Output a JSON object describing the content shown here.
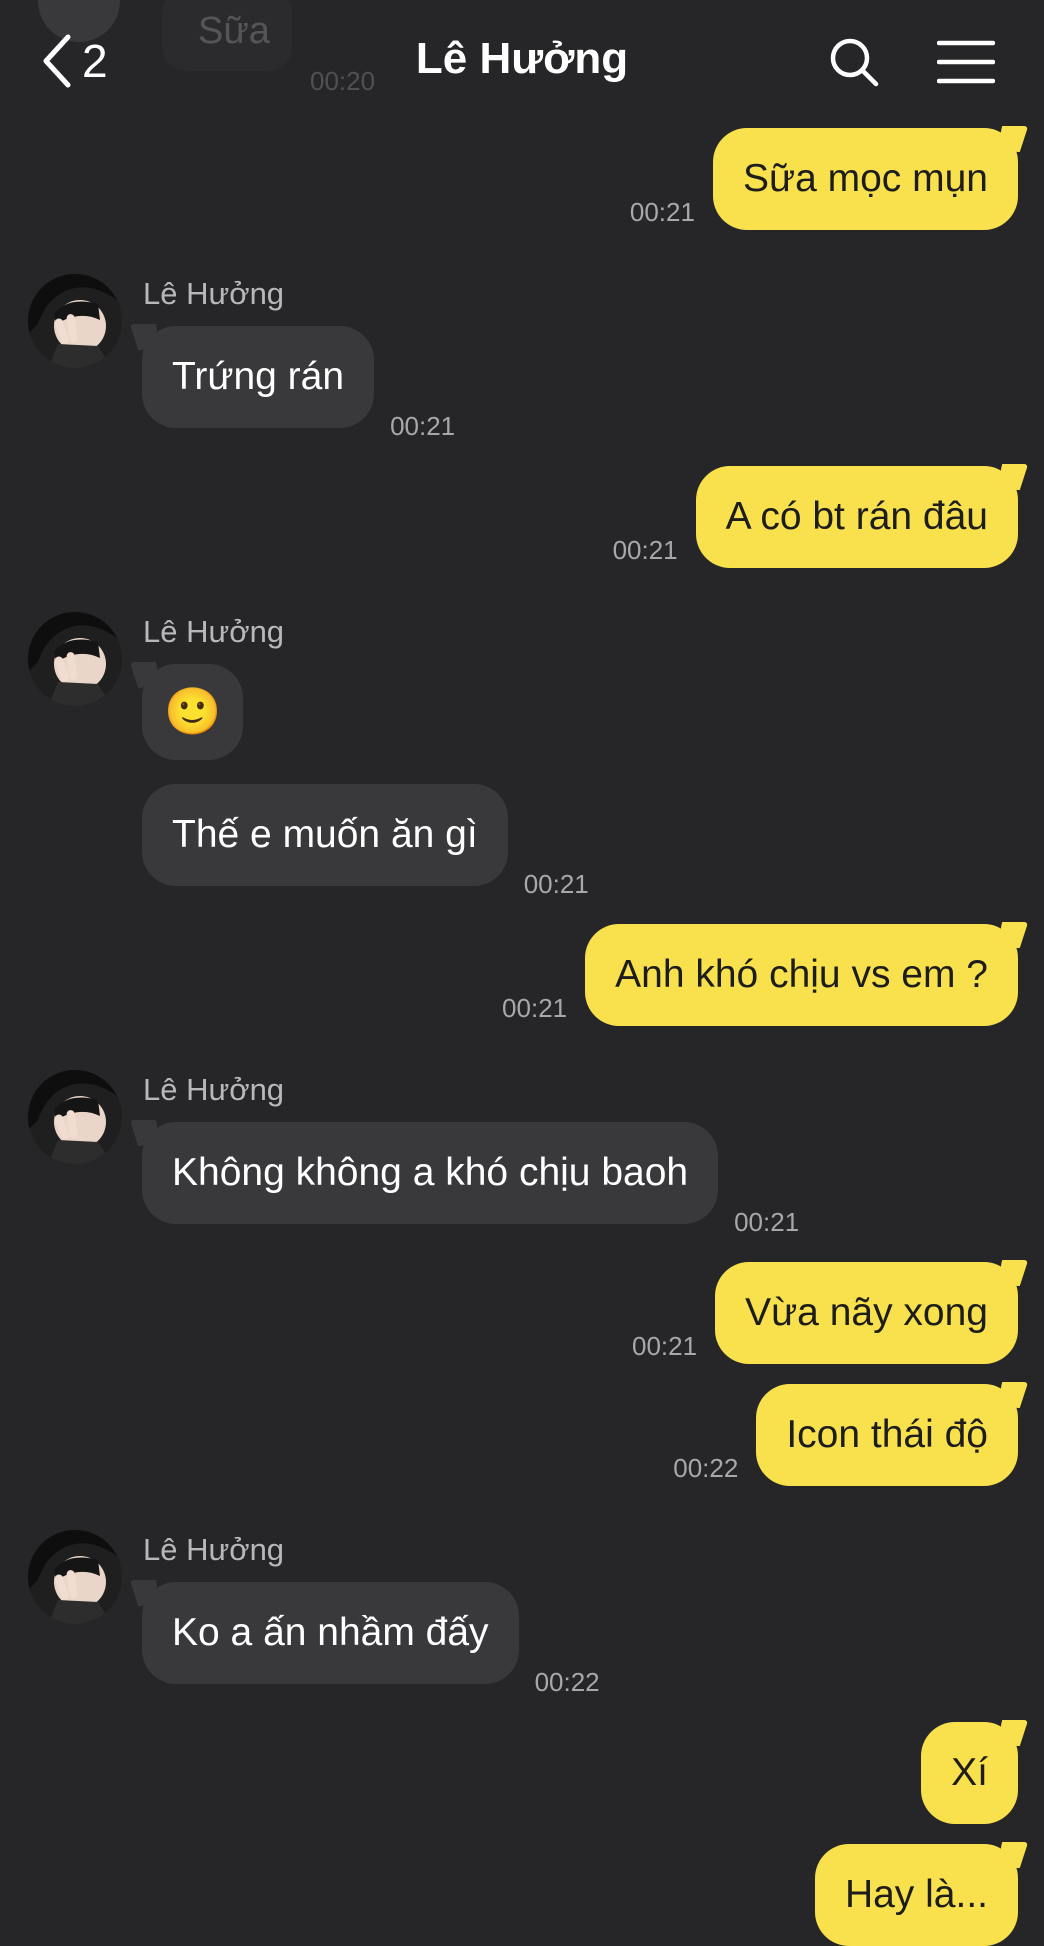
{
  "header": {
    "back_count": "2",
    "title": "Lê Hưởng"
  },
  "previous_peek": {
    "text": "Sữa",
    "time": "00:20"
  },
  "messages": [
    {
      "from": "me",
      "text": "Sữa mọc mụn",
      "time": "00:21"
    },
    {
      "from": "them",
      "sender": "Lê Hưởng",
      "text": "Trứng rán",
      "time": "00:21"
    },
    {
      "from": "me",
      "text": "A có bt rán đâu",
      "time": "00:21"
    },
    {
      "from": "them",
      "sender": "Lê Hưởng",
      "text": "🙂",
      "time": ""
    },
    {
      "from": "them",
      "sender": "",
      "text": "Thế e muốn ăn gì",
      "time": "00:21"
    },
    {
      "from": "me",
      "text": "Anh khó chịu vs em ?",
      "time": "00:21"
    },
    {
      "from": "them",
      "sender": "Lê Hưởng",
      "text": "Không không a khó chịu baoh",
      "time": "00:21"
    },
    {
      "from": "me",
      "text": "Vừa nãy xong",
      "time": "00:21"
    },
    {
      "from": "me",
      "text": "Icon thái độ",
      "time": "00:22"
    },
    {
      "from": "them",
      "sender": "Lê Hưởng",
      "text": "Ko a ấn nhầm đấy",
      "time": "00:22"
    },
    {
      "from": "me",
      "text": "Xí",
      "time": ""
    },
    {
      "from": "me",
      "text": "Hay là...",
      "time": ""
    }
  ],
  "colors": {
    "background": "#262629",
    "my_bubble": "#f8e14c",
    "their_bubble": "#39393c",
    "timestamp": "#a8a8ac"
  },
  "icons": {
    "back": "chevron-left-icon",
    "search": "search-icon",
    "menu": "menu-icon"
  }
}
